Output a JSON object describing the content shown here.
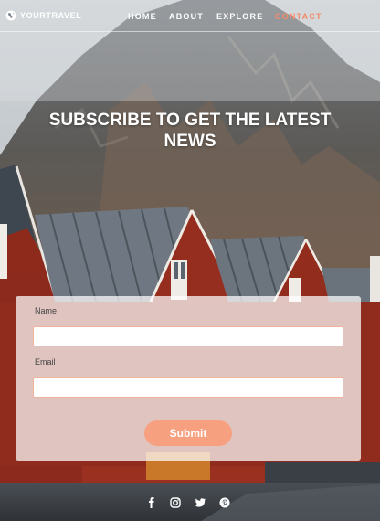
{
  "brand": {
    "name": "YOURTRAVEL",
    "icon": "globe-icon"
  },
  "nav": {
    "links": [
      {
        "label": "HOME"
      },
      {
        "label": "ABOUT"
      },
      {
        "label": "EXPLORE"
      },
      {
        "label": "CONTACT",
        "active": true
      }
    ],
    "active_color": "#f58a6a"
  },
  "hero": {
    "title": "SUBSCRIBE TO GET THE LATEST NEWS"
  },
  "form": {
    "name_label": "Name",
    "name_value": "",
    "email_label": "Email",
    "email_value": "",
    "submit_label": "Submit",
    "accent_color": "#f7a07f"
  },
  "footer": {
    "social_icons": [
      "facebook-icon",
      "instagram-icon",
      "twitter-icon",
      "pinterest-icon"
    ]
  }
}
